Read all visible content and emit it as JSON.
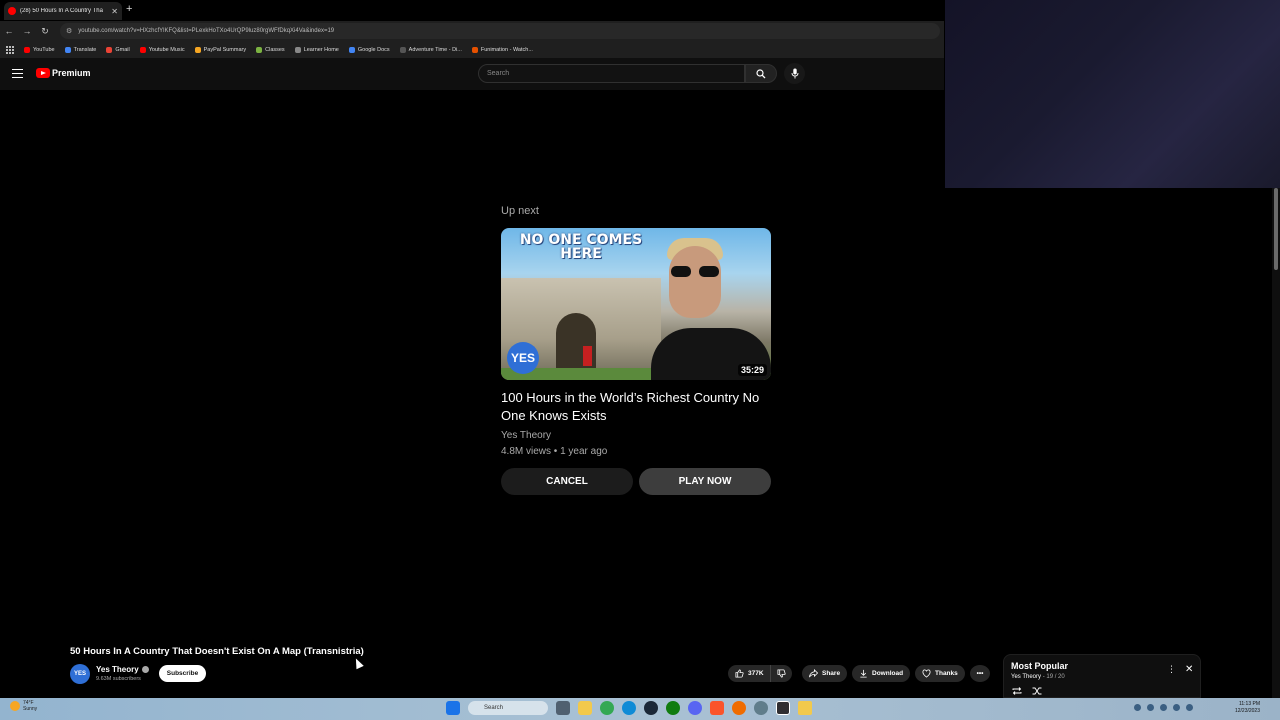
{
  "browser": {
    "tab_title": "(28) 50 Hours In A Country Tha",
    "tab_close": "✕",
    "new_tab": "+",
    "url": "youtube.com/watch?v=HXzhcfYlKFQ&list=PLexkHoTXo4UrQP9luz80rgWFfDkqXi4Va&index=19",
    "bookmarks": [
      {
        "label": "YouTube",
        "color": "#ff0000"
      },
      {
        "label": "Translate",
        "color": "#4285f4"
      },
      {
        "label": "Gmail",
        "color": "#ea4335"
      },
      {
        "label": "Youtube Music",
        "color": "#ff0000"
      },
      {
        "label": "PayPal Summary",
        "color": "#f5a623"
      },
      {
        "label": "Classes",
        "color": "#7cb342"
      },
      {
        "label": "Learner Home",
        "color": "#888888"
      },
      {
        "label": "Google Docs",
        "color": "#4285f4"
      },
      {
        "label": "Adventure Time - Di...",
        "color": "#555555"
      },
      {
        "label": "Funimation - Watch...",
        "color": "#e65100"
      }
    ]
  },
  "youtube": {
    "logo_text": "Premium",
    "search_placeholder": "Search"
  },
  "up_next": {
    "label": "Up next",
    "thumbnail_headline": "NO ONE COMES HERE",
    "thumbnail_badge": "YES",
    "duration": "35:29",
    "title": "100 Hours in the World’s Richest Country No One Knows Exists",
    "channel": "Yes Theory",
    "meta": "4.8M views • 1 year ago",
    "cancel_label": "CANCEL",
    "play_label": "PLAY NOW"
  },
  "video": {
    "title": "50 Hours In A Country That Doesn't Exist On A Map (Transnistria)",
    "channel_avatar": "YES",
    "channel": "Yes Theory",
    "subscribers": "9.63M subscribers",
    "subscribe_label": "Subscribe",
    "likes": "377K",
    "share_label": "Share",
    "download_label": "Download",
    "thanks_label": "Thanks",
    "more_label": "•••"
  },
  "playlist": {
    "title": "Most Popular",
    "channel": "Yes Theory",
    "position": "- 19 / 20",
    "close": "✕",
    "more": "⋮"
  },
  "taskbar": {
    "weather_temp": "74°F",
    "weather_desc": "Sunny",
    "search_label": "Search",
    "time": "11:13 PM",
    "date": "12/23/2023"
  }
}
